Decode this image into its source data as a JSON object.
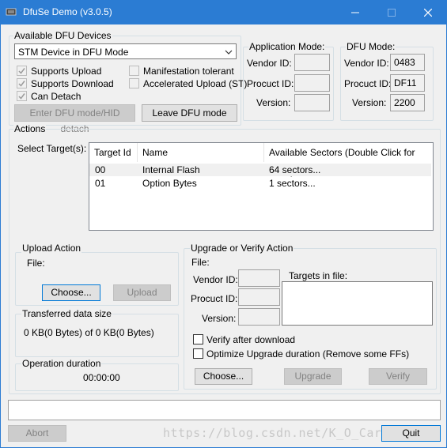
{
  "window": {
    "title": "DfuSe Demo (v3.0.5)",
    "controls": {
      "minimize": "—",
      "maximize": "□",
      "close": "✕"
    }
  },
  "devices": {
    "group_label": "Available DFU Devices",
    "selected_device": "STM Device in DFU Mode",
    "checks": [
      {
        "label": "Supports Upload",
        "checked": true
      },
      {
        "label": "Supports Download",
        "checked": true
      },
      {
        "label": "Can Detach",
        "checked": true
      },
      {
        "label": "Manifestation tolerant",
        "checked": false
      },
      {
        "label": "Accelerated Upload (ST)",
        "checked": false
      }
    ],
    "enter_dfu_button": "Enter DFU mode/HID detach",
    "leave_dfu_button": "Leave DFU mode"
  },
  "app_mode": {
    "group_label": "Application Mode:",
    "vendor_id_label": "Vendor ID:",
    "product_id_label": "Procuct ID:",
    "version_label": "Version:",
    "vendor_id": "",
    "product_id": "",
    "version": ""
  },
  "dfu_mode": {
    "group_label": "DFU Mode:",
    "vendor_id_label": "Vendor ID:",
    "product_id_label": "Procuct ID:",
    "version_label": "Version:",
    "vendor_id": "0483",
    "product_id": "DF11",
    "version": "2200"
  },
  "actions": {
    "group_label": "Actions",
    "select_targets_label": "Select Target(s):",
    "columns": [
      "Target Id",
      "Name",
      "Available Sectors (Double Click for more)"
    ],
    "rows": [
      {
        "id": "00",
        "name": "Internal Flash",
        "sectors": "64 sectors..."
      },
      {
        "id": "01",
        "name": "Option Bytes",
        "sectors": "1 sectors..."
      }
    ]
  },
  "upload": {
    "group_label": "Upload Action",
    "file_label": "File:",
    "choose_button": "Choose...",
    "upload_button": "Upload"
  },
  "transferred": {
    "group_label": "Transferred data size",
    "value": "0 KB(0 Bytes) of 0 KB(0 Bytes)"
  },
  "duration": {
    "group_label": "Operation duration",
    "value": "00:00:00"
  },
  "upgrade": {
    "group_label": "Upgrade or Verify Action",
    "file_label": "File:",
    "vendor_id_label": "Vendor ID:",
    "product_id_label": "Procuct ID:",
    "version_label": "Version:",
    "targets_in_file_label": "Targets in file:",
    "verify_after_download": "Verify after download",
    "optimize_label": "Optimize Upgrade duration (Remove some FFs)",
    "choose_button": "Choose...",
    "upgrade_button": "Upgrade",
    "verify_button": "Verify"
  },
  "footer": {
    "abort_button": "Abort",
    "quit_button": "Quit",
    "watermark": "https://blog.csdn.net/K_O_Carnivist"
  }
}
